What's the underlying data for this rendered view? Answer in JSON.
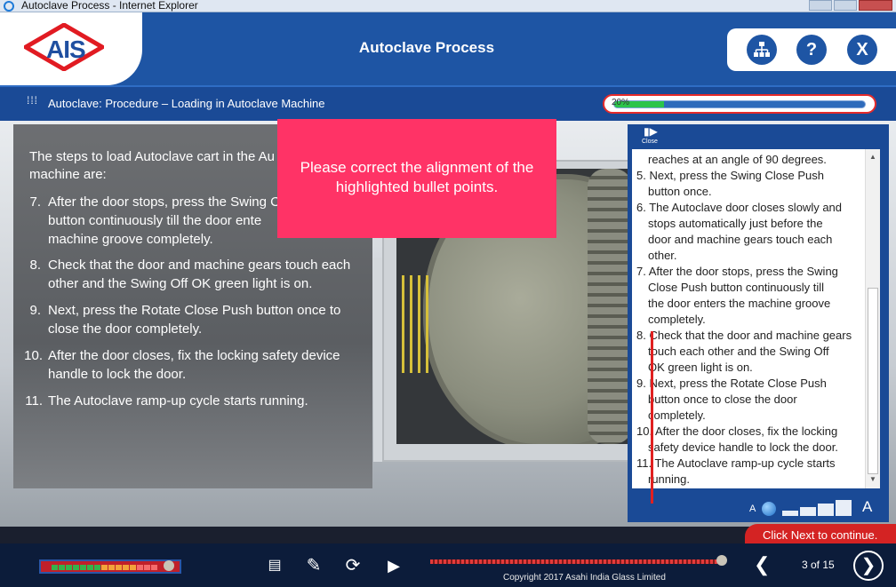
{
  "window": {
    "title": "Autoclave Process - Internet Explorer"
  },
  "header": {
    "logo": "AIS",
    "title": "Autoclave Process",
    "buttons": [
      "sitemap-icon",
      "help-icon",
      "close-icon"
    ],
    "help_label": "?",
    "close_label": "X"
  },
  "breadcrumb": {
    "text": "Autoclave: Procedure – Loading in Autoclave Machine",
    "progress_percent": 20,
    "progress_label": "20%"
  },
  "content": {
    "intro": "The steps to load Autoclave cart in the Au machine are:",
    "steps": [
      {
        "num": "7.",
        "lines": [
          "After the door stops, press the Swing C",
          "button continuously till the door ente",
          "machine groove completely."
        ]
      },
      {
        "num": "8.",
        "lines": [
          "Check that the door and machine gears touch each",
          "other and the Swing Off OK green light is on."
        ]
      },
      {
        "num": "9.",
        "lines": [
          "Next, press the Rotate Close Push button once to",
          "close the door completely."
        ]
      },
      {
        "num": "10.",
        "lines": [
          "After the door closes, fix the locking safety device",
          "handle to lock the door."
        ]
      },
      {
        "num": "11.",
        "lines": [
          "The Autoclave ramp-up cycle starts running."
        ]
      }
    ]
  },
  "feedback_note": "Please correct the alignment of the highlighted bullet points.",
  "transcript": {
    "close_label": "Close",
    "lines": [
      "reaches at an angle of 90 degrees.",
      "5. Next, press the Swing Close Push",
      "button once.",
      "6. The Autoclave door closes slowly and",
      "stops automatically just before the",
      "door and machine gears touch each",
      "other.",
      "7. After the door stops, press the Swing",
      "Close Push button continuously till",
      "the door enters the machine groove",
      "completely.",
      "8. Check that the door and machine gears",
      "touch each other and the Swing Off",
      "OK green light is on.",
      "9. Next, press the Rotate Close Push",
      "button once to close the door",
      "completely.",
      "10. After the door closes, fix the locking",
      "safety device handle to lock the door.",
      "11. The Autoclave ramp-up cycle starts",
      "running."
    ],
    "font_small": "A",
    "font_large": "A"
  },
  "footer": {
    "continue_text": "Click Next to continue.",
    "page_text": "3 of 15",
    "copyright": "Copyright 2017 Asahi India Glass Limited",
    "icons": [
      "notes-icon",
      "pencil-icon",
      "replay-icon",
      "play-icon"
    ],
    "play_glyph": "▶",
    "replay_glyph": "⟳",
    "notes_glyph": "▤",
    "pencil_glyph": "✎",
    "prev_glyph": "❮",
    "next_glyph": "❯"
  },
  "colors": {
    "brand_blue": "#1e55a4",
    "accent_red": "#d42323",
    "note_pink": "#ff3366",
    "progress_green": "#2cc44a"
  }
}
